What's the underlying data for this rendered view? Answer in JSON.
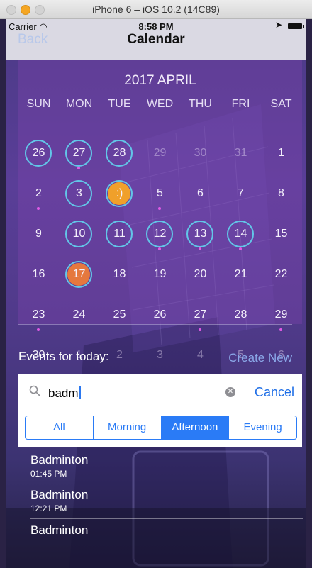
{
  "window": {
    "title": "iPhone 6 – iOS 10.2 (14C89)",
    "traffic_lights": [
      "#d6d6d6",
      "#f5a623",
      "#d6d6d6"
    ]
  },
  "status": {
    "carrier": "Carrier",
    "time": "8:58 PM"
  },
  "nav": {
    "back": "Back",
    "title": "Calendar"
  },
  "calendar": {
    "month": "2017 APRIL",
    "weekdays": [
      "SUN",
      "MON",
      "TUE",
      "WED",
      "THU",
      "FRI",
      "SAT"
    ],
    "weeks": [
      [
        "26",
        "27",
        "28",
        "29",
        "30",
        "31",
        "1"
      ],
      [
        "2",
        "3",
        ":)",
        "5",
        "6",
        "7",
        "8"
      ],
      [
        "9",
        "10",
        "11",
        "12",
        "13",
        "14",
        "15"
      ],
      [
        "16",
        "17",
        "18",
        "19",
        "20",
        "21",
        "22"
      ],
      [
        "23",
        "24",
        "25",
        "26",
        "27",
        "28",
        "29"
      ],
      [
        "30",
        "1",
        "2",
        "3",
        "4",
        "5",
        "6"
      ]
    ],
    "muted_cells": [
      [
        0,
        3
      ],
      [
        0,
        4
      ],
      [
        0,
        5
      ],
      [
        5,
        1
      ],
      [
        5,
        2
      ],
      [
        5,
        3
      ],
      [
        5,
        4
      ],
      [
        5,
        5
      ],
      [
        5,
        6
      ]
    ],
    "ringed_cells": [
      [
        0,
        0
      ],
      [
        0,
        1
      ],
      [
        0,
        2
      ],
      [
        1,
        1
      ],
      [
        1,
        2
      ],
      [
        2,
        1
      ],
      [
        2,
        2
      ],
      [
        2,
        3
      ],
      [
        2,
        4
      ],
      [
        2,
        5
      ],
      [
        3,
        1
      ]
    ],
    "filled_cells": [
      {
        "cell": [
          1,
          2
        ],
        "color": "#f0a02a"
      },
      {
        "cell": [
          3,
          1
        ],
        "color": "#e5783e"
      }
    ],
    "dot_cells": [
      [
        0,
        1
      ],
      [
        1,
        0
      ],
      [
        1,
        3
      ],
      [
        2,
        3
      ],
      [
        2,
        4
      ],
      [
        2,
        5
      ],
      [
        4,
        0
      ],
      [
        4,
        4
      ],
      [
        4,
        6
      ]
    ]
  },
  "events": {
    "header": "Events for today:",
    "create_new": "Create New"
  },
  "search": {
    "value": "badm",
    "cancel": "Cancel",
    "segments": [
      "All",
      "Morning",
      "Afternoon",
      "Evening"
    ],
    "selected_segment": "Afternoon"
  },
  "results": [
    {
      "name": "Badminton",
      "time": "01:45 PM"
    },
    {
      "name": "Badminton",
      "time": "12:21 PM"
    },
    {
      "name": "Badminton",
      "time": ""
    }
  ],
  "colors": {
    "ring": "#62c6e8",
    "dot": "#e15ae6",
    "accent_blue": "#2a7bf6",
    "link_blue": "#8ba8e8"
  }
}
